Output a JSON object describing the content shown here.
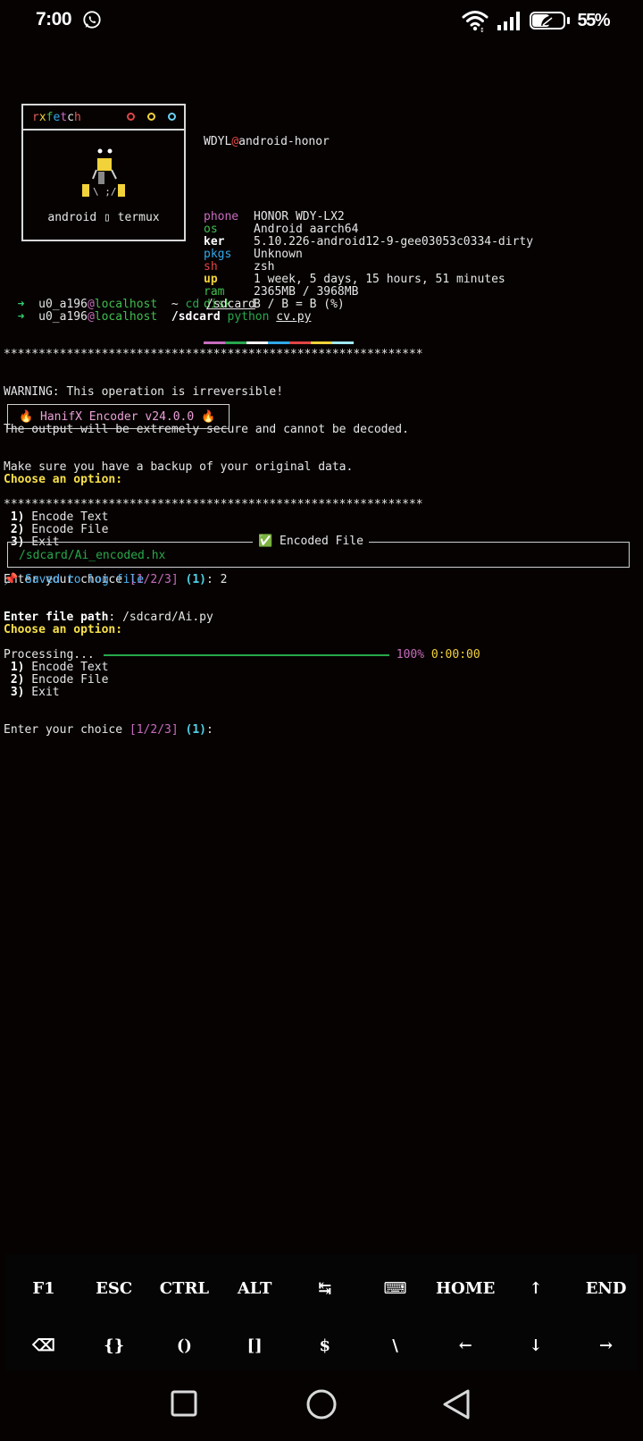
{
  "status_bar": {
    "time": "7:00",
    "battery_percent": "55%",
    "battery_level": 0.55,
    "icons": [
      "whatsapp-icon",
      "wifi-icon",
      "signal-icon",
      "battery-saver-icon"
    ]
  },
  "fetch": {
    "title_chars": [
      "r",
      "x",
      "f",
      "e",
      "t",
      "c",
      "h"
    ],
    "title_colors": [
      "#e05a5a",
      "#f2d23a",
      "#3fbf4f",
      "#31a8e8",
      "#c86cbe",
      "#e6e6e6",
      "#e05a5a"
    ],
    "dot_colors": [
      "#e04545",
      "#f2d23a",
      "#6ad0f2"
    ],
    "logo_eyes": "•.•",
    "caption": "android ▯ termux",
    "user": "WDYL",
    "at": "@",
    "host": "android-honor",
    "rows": [
      {
        "label": "phone",
        "value": "HONOR WDY-LX2",
        "cls": "lbl-mag"
      },
      {
        "label": "os",
        "value": "Android aarch64",
        "cls": "lbl-grn"
      },
      {
        "label": "ker",
        "value": "5.10.226-android12-9-gee03053c0334-dirty",
        "cls": "lbl-wht"
      },
      {
        "label": "pkgs",
        "value": "Unknown",
        "cls": "lbl-blu"
      },
      {
        "label": "sh",
        "value": "zsh",
        "cls": "lbl-red"
      },
      {
        "label": "up",
        "value": "1 week, 5 days, 15 hours, 51 minutes",
        "cls": "lbl-yel"
      },
      {
        "label": "ram",
        "value": "2365MB / 3968MB",
        "cls": "lbl-grn"
      },
      {
        "label": "disk",
        "value": "B / B = B (%)",
        "cls": "lbl-grn"
      }
    ],
    "palette": [
      "#c86cbe",
      "#27a84b",
      "#ffffff",
      "#31a8e8",
      "#e04545",
      "#f2d23a",
      "#9fe8f4"
    ]
  },
  "prompt": {
    "arrow": "➜",
    "user": "u0_a196",
    "at": "@",
    "host": "localhost",
    "line1_dir": "~",
    "line1_cmd": "cd",
    "line1_arg": "/sdcard",
    "line2_dir": "/sdcard",
    "line2_cmd": "python",
    "line2_arg": "cv.py"
  },
  "warning": {
    "stars": "************************************************************",
    "line1": "WARNING: This operation is irreversible!",
    "line2": "The output will be extremely secure and cannot be decoded.",
    "line3": "Make sure you have a backup of your original data."
  },
  "banner": "🔥 HanifX Encoder v24.0.0 🔥",
  "menu1": {
    "heading": "Choose an option:",
    "items": [
      {
        "num": "1)",
        "label": "Encode Text"
      },
      {
        "num": "2)",
        "label": "Encode File"
      },
      {
        "num": "3)",
        "label": "Exit"
      }
    ],
    "prompt_text": "Enter your choice ",
    "choices": "[1/2/3]",
    "default": "(1)",
    "colon": ": ",
    "answer": "2"
  },
  "file_prompt": {
    "label": "Enter file path",
    "colon": ": ",
    "value": "/sdcard/Ai.py"
  },
  "progress": {
    "label": "Processing...",
    "percent": "100%",
    "elapsed": "0:00:00",
    "fraction": 1.0
  },
  "encoded": {
    "title": "✅ Encoded File",
    "path": "/sdcard/Ai_encoded.hx"
  },
  "saved": "📌 Saved to log file",
  "menu2": {
    "heading": "Choose an option:",
    "items": [
      {
        "num": "1)",
        "label": "Encode Text"
      },
      {
        "num": "2)",
        "label": "Encode File"
      },
      {
        "num": "3)",
        "label": "Exit"
      }
    ],
    "prompt_text": "Enter your choice ",
    "choices": "[1/2/3]",
    "default": "(1)",
    "colon": ":"
  },
  "extra_keys": {
    "row1": [
      "F1",
      "ESC",
      "CTRL",
      "ALT",
      "↹",
      "⌨",
      "HOME",
      "↑",
      "END"
    ],
    "row2": [
      "⌫",
      "{}",
      "()",
      "[]",
      "$",
      "\\",
      "←",
      "↓",
      "→"
    ]
  },
  "nav": {
    "icons": [
      "recents-icon",
      "home-icon",
      "back-icon"
    ]
  }
}
